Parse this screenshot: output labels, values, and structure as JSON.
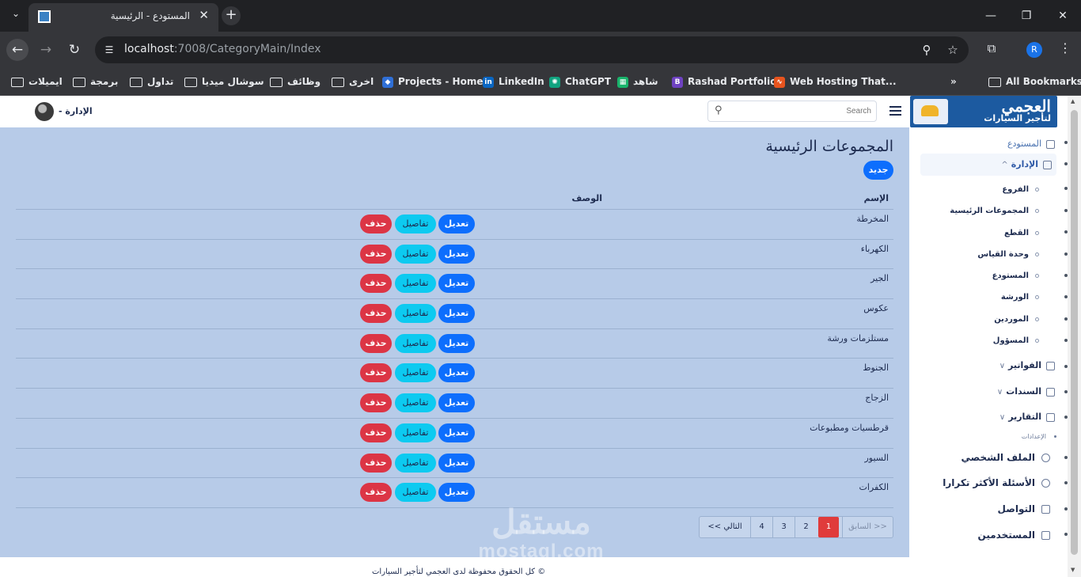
{
  "browser": {
    "tab_title": "المستودع - الرئيسية",
    "url_host": "localhost",
    "url_path": ":7008/CategoryMain/Index",
    "profile_initial": "R",
    "bookmarks": [
      "ايميلات",
      "برمجة",
      "تداول",
      "سوشال ميديا",
      "وظائف",
      "اخرى",
      "Projects - Home",
      "LinkedIn",
      "ChatGPT",
      "شاهد",
      "Rashad Portfolio",
      "Web Hosting That...",
      "All Bookmarks"
    ],
    "overflow_label": "»"
  },
  "header": {
    "search_placeholder": "Search",
    "user_label": "الإدارة -"
  },
  "sidebar": {
    "brand_title": "العجمي",
    "brand_subtitle": "لتأجير السيارات",
    "items": {
      "warehouse_top": "المستودع",
      "admin": "الإدارة",
      "branches": "الفروع",
      "main_groups": "المجموعات الرئيسية",
      "parts": "القطع",
      "unit": "وحدة القياس",
      "warehouse": "المستودع",
      "workshop": "الورشة",
      "suppliers": "الموردين",
      "responsible": "المسؤول",
      "invoices": "الفواتير",
      "vouchers": "السندات",
      "reports": "التقارير",
      "settings_heading": "الإعدادات",
      "profile": "الملف الشخصي",
      "faq": "الأسئلة الأكثر تكرارا",
      "contact": "التواصل",
      "users": "المستخدمين"
    }
  },
  "main": {
    "page_title": "المجموعات الرئيسية",
    "new_button": "جديد",
    "col_name": "الإسم",
    "col_desc": "الوصف",
    "edit_label": "تعديل",
    "details_label": "تفاصيل",
    "delete_label": "حذف",
    "rows": [
      "المخرطة",
      "الكهرباء",
      "الجير",
      "عكوس",
      "مستلزمات ورشة",
      "الجنوط",
      "الزجاج",
      "قرطسيات ومطبوعات",
      "السيور",
      "الكفرات"
    ],
    "pager": {
      "prev": "<< السابق",
      "pages": [
        "1",
        "2",
        "3",
        "4"
      ],
      "active_page": "1",
      "next": "التالي >>"
    }
  },
  "watermark": {
    "arabic": "مستقل",
    "latin": "mostaql.com"
  },
  "footer": {
    "text": "© كل الحقوق محفوظة لدى العجمي لتأجير السيارات"
  }
}
